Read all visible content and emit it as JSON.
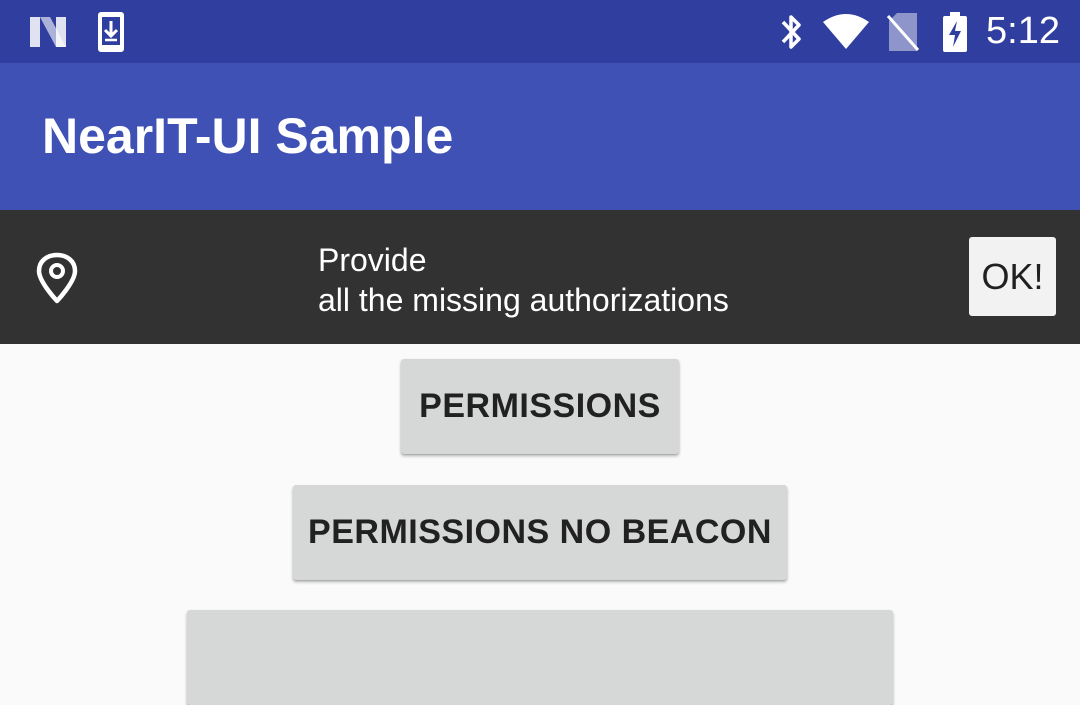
{
  "status_bar": {
    "time": "5:12",
    "left_icons": [
      "n-logo-icon",
      "download-icon"
    ],
    "right_icons": [
      "bluetooth-icon",
      "wifi-icon",
      "no-sim-icon",
      "battery-charging-icon"
    ]
  },
  "app_bar": {
    "title": "NearIT-UI Sample",
    "color": "#3f51b5"
  },
  "banner": {
    "icon": "location-pin-icon",
    "line1": "Provide",
    "line2": "all the missing authorizations",
    "ok_label": "OK!"
  },
  "buttons": [
    {
      "label": "PERMISSIONS"
    },
    {
      "label": "PERMISSIONS NO BEACON"
    },
    {
      "label": ""
    }
  ],
  "colors": {
    "status_bar": "#303f9f",
    "app_bar": "#3f51b5",
    "banner": "#323232",
    "button": "#d6d7d7"
  }
}
